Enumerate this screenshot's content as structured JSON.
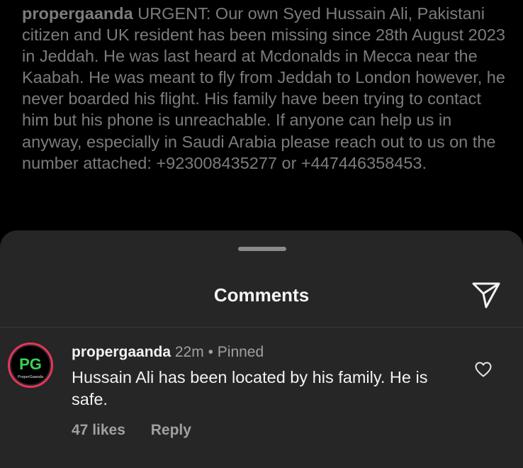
{
  "post": {
    "username": "propergaanda",
    "caption": "URGENT: Our own Syed Hussain Ali, Pakistani citizen and UK resident has been missing since 28th August 2023 in Jeddah. He was last heard at Mcdonalds in Mecca near the Kaabah. He was meant to fly from Jeddah to London however, he never boarded his flight. His family have been trying to contact him but his phone is unreachable. If anyone can help us in anyway, especially in Saudi Arabia please reach out to us on the number attached: +923008435277 or +447446358453."
  },
  "comments_sheet": {
    "title": "Comments",
    "share_icon": "paper-plane-icon",
    "comment": {
      "avatar_text": "PG",
      "avatar_subtext": "ProperGaanda",
      "avatar_colors": {
        "ring": "#e8345a",
        "letters": "#39d353"
      },
      "username": "propergaanda",
      "time": "22m",
      "separator": "•",
      "pinned": "Pinned",
      "text": "Hussain Ali has been located by his family. He is safe.",
      "likes": "47 likes",
      "reply": "Reply",
      "like_icon": "heart-icon"
    }
  }
}
